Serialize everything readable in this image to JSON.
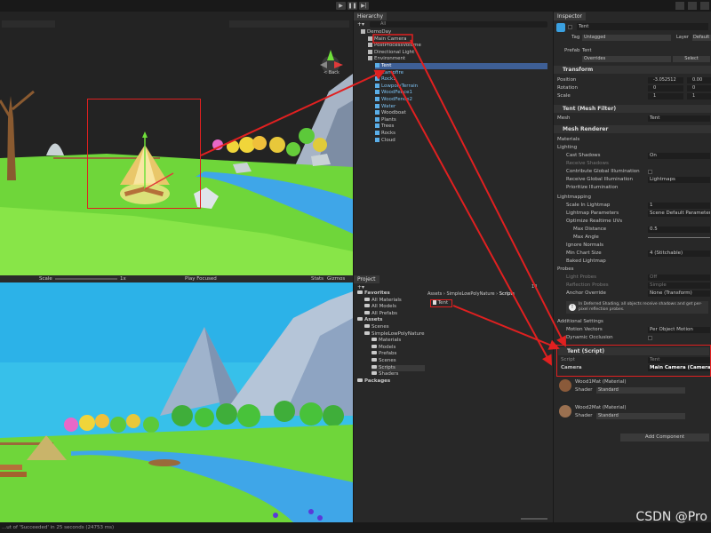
{
  "toolbar": {
    "play": "▶",
    "pause": "❚❚",
    "step": "▶|"
  },
  "scene": {
    "back_label": "< Back"
  },
  "game": {
    "scale_label": "Scale",
    "scale_value": "1x",
    "play_mode": "Play Focused",
    "stats": "Stats",
    "gizmos": "Gizmos"
  },
  "hierarchy": {
    "tab": "Hierarchy",
    "search_placeholder": "All",
    "items": [
      {
        "label": "DemoDay",
        "depth": 0
      },
      {
        "label": "Main Camera",
        "depth": 1
      },
      {
        "label": "PostProcessVolume",
        "depth": 1
      },
      {
        "label": "Directional Light",
        "depth": 1
      },
      {
        "label": "Environment",
        "depth": 1
      },
      {
        "label": "Tent",
        "depth": 2
      },
      {
        "label": "Campfire",
        "depth": 2
      },
      {
        "label": "Rock1",
        "depth": 2
      },
      {
        "label": "LowpolyTerrain",
        "depth": 2
      },
      {
        "label": "WoodFence1",
        "depth": 2
      },
      {
        "label": "WoodFence2",
        "depth": 2
      },
      {
        "label": "Water",
        "depth": 2
      },
      {
        "label": "Woodboat",
        "depth": 2
      },
      {
        "label": "Plants",
        "depth": 2
      },
      {
        "label": "Trees",
        "depth": 2
      },
      {
        "label": "Rocks",
        "depth": 2
      },
      {
        "label": "Cloud",
        "depth": 2
      }
    ]
  },
  "project": {
    "tab": "Project",
    "count": "14",
    "breadcrumb": [
      "Assets",
      "SimpleLowPolyNature",
      "Scripts"
    ],
    "file": "Tent",
    "tree": [
      {
        "label": "Favorites",
        "depth": 0
      },
      {
        "label": "All Materials",
        "depth": 1
      },
      {
        "label": "All Models",
        "depth": 1
      },
      {
        "label": "All Prefabs",
        "depth": 1
      },
      {
        "label": "Assets",
        "depth": 0
      },
      {
        "label": "Scenes",
        "depth": 1
      },
      {
        "label": "SimpleLowPolyNature",
        "depth": 1
      },
      {
        "label": "Materials",
        "depth": 2
      },
      {
        "label": "Models",
        "depth": 2
      },
      {
        "label": "Prefabs",
        "depth": 2
      },
      {
        "label": "Scenes",
        "depth": 2
      },
      {
        "label": "Scripts",
        "depth": 2
      },
      {
        "label": "Shaders",
        "depth": 2
      },
      {
        "label": "Packages",
        "depth": 0
      }
    ]
  },
  "inspector": {
    "tab": "Inspector",
    "object_name": "Tent",
    "tag_label": "Tag",
    "tag_value": "Untagged",
    "layer_label": "Layer",
    "layer_value": "Default",
    "prefab_label": "Prefab",
    "prefab_value": "Tent",
    "overrides": "Overrides",
    "select": "Select",
    "transform": "Transform",
    "position_label": "Position",
    "position_x": "-3.052512",
    "position_y": "0.00",
    "rotation_label": "Rotation",
    "rotation_x": "0",
    "rotation_y": "0",
    "scale_label": "Scale",
    "scale_x": "1",
    "scale_y": "1",
    "mesh_filter": "Tent (Mesh Filter)",
    "mesh_label": "Mesh",
    "mesh_value": "Tent",
    "mesh_renderer": "Mesh Renderer",
    "materials": "Materials",
    "lighting": "Lighting",
    "cast_shadows": "Cast Shadows",
    "cast_shadows_value": "On",
    "receive_shadows": "Receive Shadows",
    "contribute_gi": "Contribute Global Illumination",
    "receive_gi": "Receive Global Illumination",
    "receive_gi_value": "Lightmaps",
    "prioritize": "Prioritize Illumination",
    "lightmapping": "Lightmapping",
    "scale_lightmap": "Scale In Lightmap",
    "scale_lightmap_value": "1",
    "lightmap_params": "Lightmap Parameters",
    "lightmap_params_value": "Scene Default Parameters",
    "optimize_uvs": "Optimize Realtime UVs",
    "max_distance": "Max Distance",
    "max_distance_value": "0.5",
    "max_angle": "Max Angle",
    "ignore_normals": "Ignore Normals",
    "min_chart": "Min Chart Size",
    "min_chart_value": "4 (Stitchable)",
    "baked_lightmap": "Baked Lightmap",
    "probes": "Probes",
    "light_probes": "Light Probes",
    "light_probes_value": "Off",
    "reflection_probes": "Reflection Probes",
    "reflection_probes_value": "Simple",
    "anchor_override": "Anchor Override",
    "anchor_value": "None (Transform)",
    "deferred_note": "In Deferred Shading, all objects receive shadows and get per-pixel reflection probes.",
    "additional": "Additional Settings",
    "motion_vectors": "Motion Vectors",
    "motion_value": "Per Object Motion",
    "dynamic_occlusion": "Dynamic Occlusion",
    "script_component": "Tent (Script)",
    "script_label": "Script",
    "script_value": "Tent",
    "camera_label": "Camera",
    "camera_value": "Main Camera (Camera)",
    "mat1": "Wood1Mat (Material)",
    "mat2": "Wood2Mat (Material)",
    "shader_label": "Shader",
    "shader_value": "Standard",
    "add_component": "Add Component"
  },
  "status": "...ut of 'Succeeded' in 25 seconds (24753 ms)",
  "watermark": "CSDN @Pro"
}
